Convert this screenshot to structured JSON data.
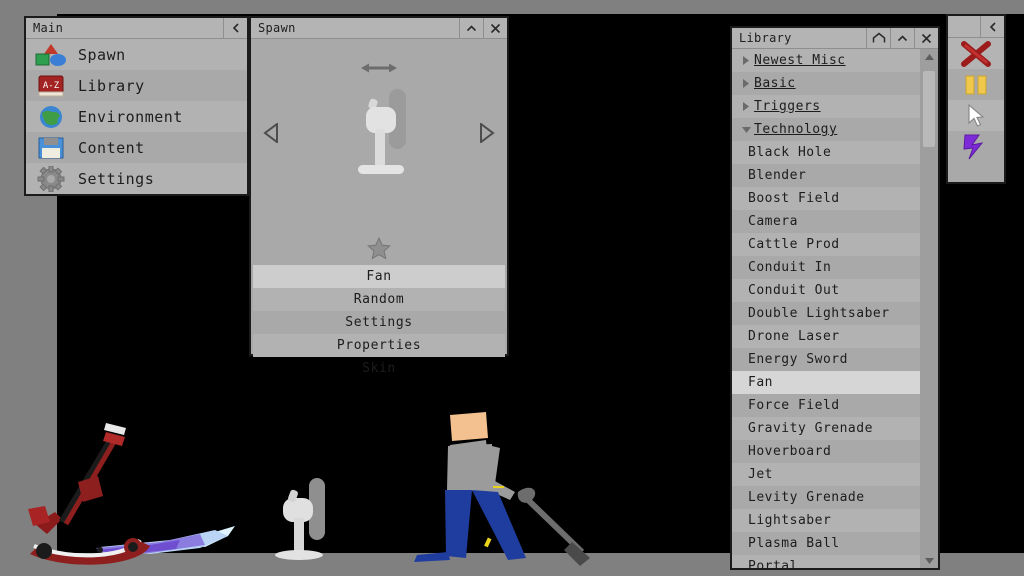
{
  "main_menu": {
    "title": "Main",
    "collapse_label": "<",
    "items": [
      {
        "label": "Spawn",
        "icon": "shapes-icon"
      },
      {
        "label": "Library",
        "icon": "az-book-icon"
      },
      {
        "label": "Environment",
        "icon": "globe-icon"
      },
      {
        "label": "Content",
        "icon": "floppy-disk-icon"
      },
      {
        "label": "Settings",
        "icon": "gear-icon"
      }
    ]
  },
  "spawn": {
    "title": "Spawn",
    "collapse_label": "^",
    "close_label": "X",
    "preview_item": "Fan",
    "move_icon": "horizontal-double-arrow-icon",
    "prev_icon": "left-triangle-icon",
    "next_icon": "right-triangle-icon",
    "favorite_icon": "star-icon",
    "buttons": [
      {
        "label": "Fan",
        "selected": true
      },
      {
        "label": "Random",
        "selected": false
      },
      {
        "label": "Settings",
        "selected": false
      },
      {
        "label": "Properties",
        "selected": false
      },
      {
        "label": "Skin",
        "selected": false
      }
    ]
  },
  "library": {
    "title": "Library",
    "home_label": "home-icon",
    "collapse_label": "^",
    "close_label": "X",
    "categories": [
      {
        "label": "Newest Misc",
        "expanded": false
      },
      {
        "label": "Basic",
        "expanded": false
      },
      {
        "label": "Triggers",
        "expanded": false
      },
      {
        "label": "Technology",
        "expanded": true
      }
    ],
    "items": [
      {
        "label": "Black Hole",
        "selected": false
      },
      {
        "label": "Blender",
        "selected": false
      },
      {
        "label": "Boost Field",
        "selected": false
      },
      {
        "label": "Camera",
        "selected": false
      },
      {
        "label": "Cattle Prod",
        "selected": false
      },
      {
        "label": "Conduit In",
        "selected": false
      },
      {
        "label": "Conduit Out",
        "selected": false
      },
      {
        "label": "Double Lightsaber",
        "selected": false
      },
      {
        "label": "Drone Laser",
        "selected": false
      },
      {
        "label": "Energy Sword",
        "selected": false
      },
      {
        "label": "Fan",
        "selected": true
      },
      {
        "label": "Force Field",
        "selected": false
      },
      {
        "label": "Gravity Grenade",
        "selected": false
      },
      {
        "label": "Hoverboard",
        "selected": false
      },
      {
        "label": "Jet",
        "selected": false
      },
      {
        "label": "Levity Grenade",
        "selected": false
      },
      {
        "label": "Lightsaber",
        "selected": false
      },
      {
        "label": "Plasma Ball",
        "selected": false
      },
      {
        "label": "Portal",
        "selected": false
      }
    ],
    "scroll_up_icon": "triangle-up-icon",
    "scroll_down_icon": "triangle-down-icon"
  },
  "toolbar": {
    "collapse_label": "<",
    "tools": [
      {
        "name": "delete-tool",
        "icon": "red-x-icon"
      },
      {
        "name": "pause-tool",
        "icon": "yellow-pause-icon"
      },
      {
        "name": "select-tool",
        "icon": "cursor-arrow-icon"
      },
      {
        "name": "electric-tool",
        "icon": "purple-lightning-icon"
      }
    ]
  },
  "scene": {
    "objects": [
      "red-scooter",
      "fan",
      "ragdoll-human",
      "shovel"
    ]
  },
  "colors": {
    "panel": "#a9a9a9",
    "titlebar": "#b4b4b4",
    "selected": "#d6d6d6",
    "border": "#1b1b1b",
    "scene_bg": "#000000",
    "floor": "#808080",
    "accent_red": "#a32222",
    "accent_yellow": "#f0c84b",
    "accent_purple": "#8a2be2"
  }
}
